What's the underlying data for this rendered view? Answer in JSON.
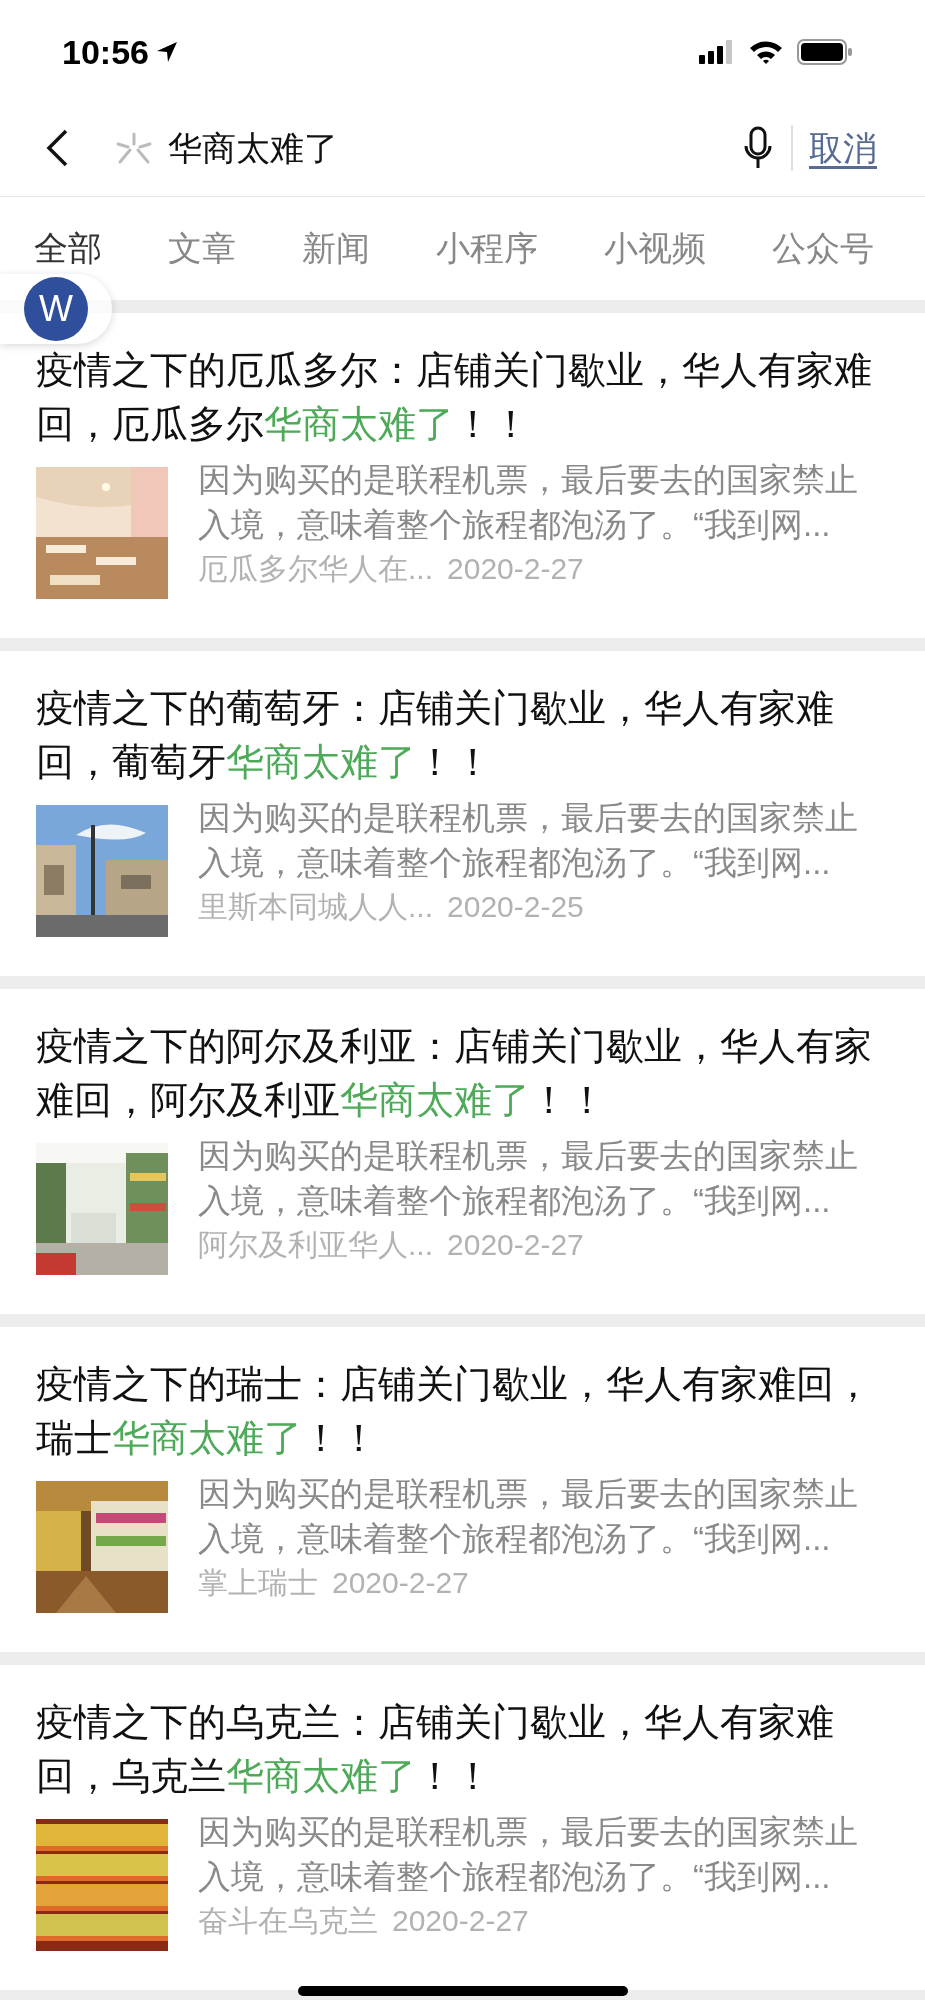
{
  "status_bar": {
    "time": "10:56"
  },
  "search": {
    "query": "华商太难了",
    "cancel": "取消"
  },
  "tabs": [
    {
      "label": "全部",
      "selected": true
    },
    {
      "label": "文章",
      "selected": false
    },
    {
      "label": "新闻",
      "selected": false
    },
    {
      "label": "小程序",
      "selected": false
    },
    {
      "label": "小视频",
      "selected": false
    },
    {
      "label": "公众号",
      "selected": false
    }
  ],
  "floating_badge": {
    "letter": "W"
  },
  "results": [
    {
      "title_prefix": "疫情之下的厄瓜多尔：店铺关门歇业，华人有家难回，厄瓜多尔",
      "highlight": "华商太难了",
      "title_suffix": "！！",
      "snippet": "因为购买的是联程机票，最后要去的国家禁止入境，意味着整个旅程都泡汤了。“我到网...",
      "source": "厄瓜多尔华人在...",
      "date": "2020-2-27"
    },
    {
      "title_prefix": "疫情之下的葡萄牙：店铺关门歇业，华人有家难回，葡萄牙",
      "highlight": "华商太难了",
      "title_suffix": "！！",
      "snippet": "因为购买的是联程机票，最后要去的国家禁止入境，意味着整个旅程都泡汤了。“我到网...",
      "source": "里斯本同城人人...",
      "date": "2020-2-25"
    },
    {
      "title_prefix": "疫情之下的阿尔及利亚：店铺关门歇业，华人有家难回，阿尔及利亚",
      "highlight": "华商太难了",
      "title_suffix": "！！",
      "snippet": "因为购买的是联程机票，最后要去的国家禁止入境，意味着整个旅程都泡汤了。“我到网...",
      "source": "阿尔及利亚华人...",
      "date": "2020-2-27"
    },
    {
      "title_prefix": "疫情之下的瑞士：店铺关门歇业，华人有家难回，瑞士",
      "highlight": "华商太难了",
      "title_suffix": "！！",
      "snippet": "因为购买的是联程机票，最后要去的国家禁止入境，意味着整个旅程都泡汤了。“我到网...",
      "source": "掌上瑞士",
      "date": "2020-2-27"
    },
    {
      "title_prefix": "疫情之下的乌克兰：店铺关门歇业，华人有家难回，乌克兰",
      "highlight": "华商太难了",
      "title_suffix": "！！",
      "snippet": "因为购买的是联程机票，最后要去的国家禁止入境，意味着整个旅程都泡汤了。“我到网...",
      "source": "奋斗在乌克兰",
      "date": "2020-2-27"
    }
  ]
}
